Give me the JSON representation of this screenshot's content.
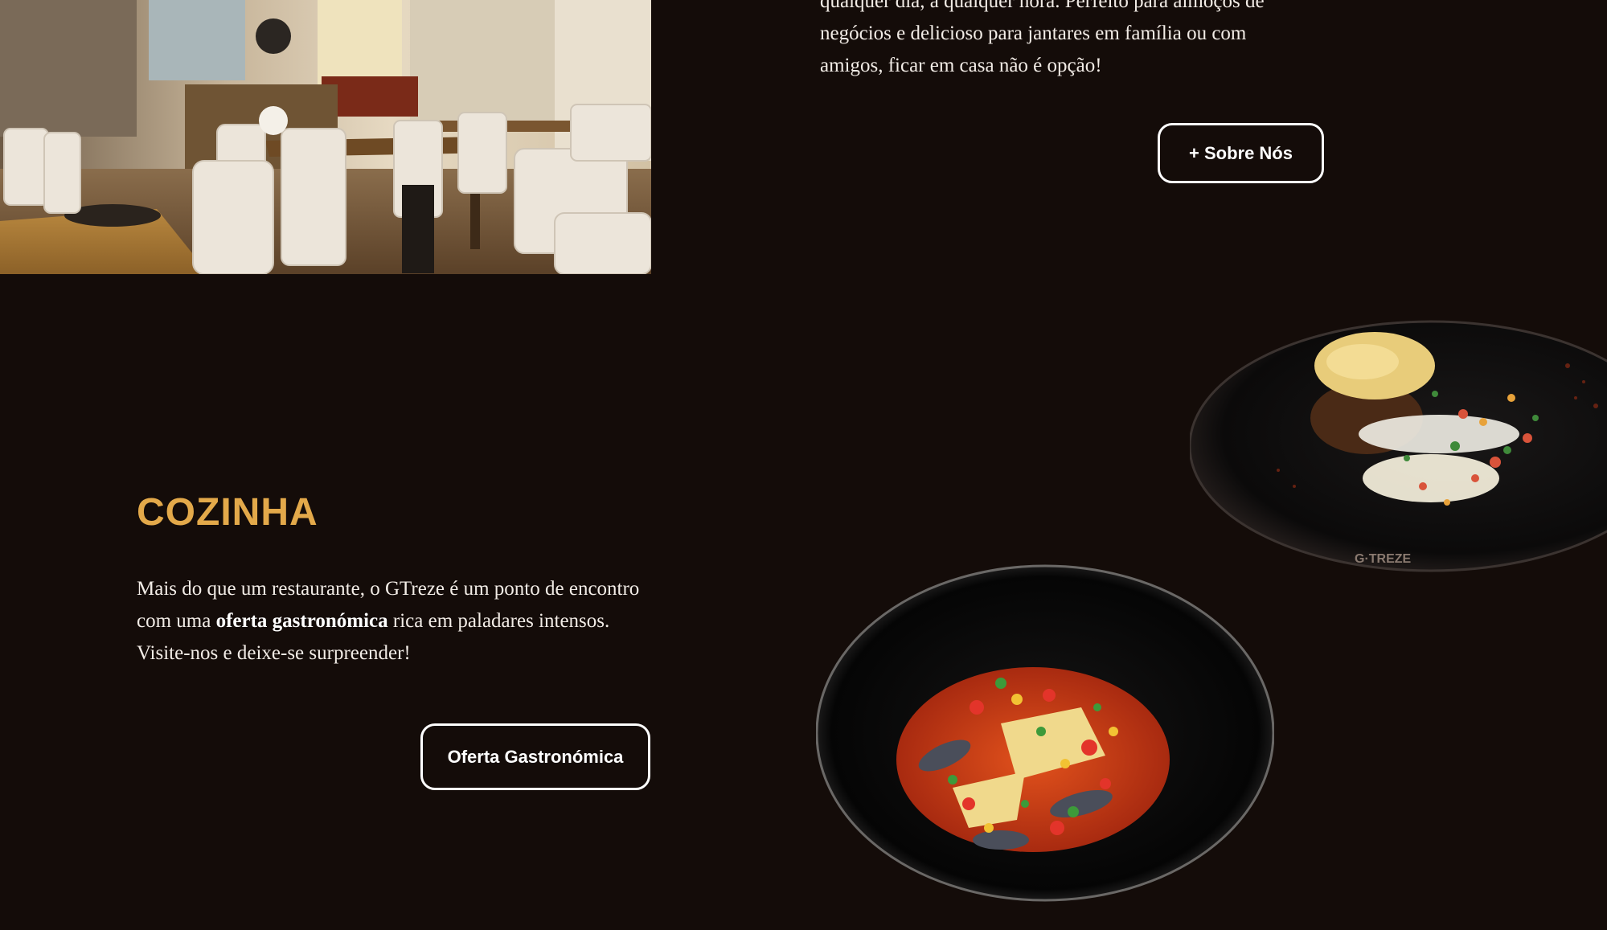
{
  "about": {
    "text_line1": "qualquer dia, a qualquer hora. Perfeito para almoços de",
    "text_line2": "negócios e delicioso para jantares em família ou com",
    "text_line3": "amigos, ficar em casa não é opção!",
    "button_label": "+ Sobre Nós"
  },
  "cozinha": {
    "title": "COZINHA",
    "text_before": "Mais do que um restaurante, o GTreze é um ponto de encontro com uma ",
    "text_bold": "oferta gastronómica",
    "text_after": " rica em paladares intensos. Visite-nos e deixe-se surpreender!",
    "button_label": "Oferta Gastronómica"
  },
  "images": {
    "restaurant": "restaurant-interior-photo",
    "dish_top": "plated-dish-photo",
    "dish_bottom": "bowl-dish-photo",
    "watermark": "G·TREZE"
  },
  "colors": {
    "background": "#140c09",
    "accent": "#e3a94a",
    "text": "#f2ece6",
    "button_border": "#ffffff"
  }
}
